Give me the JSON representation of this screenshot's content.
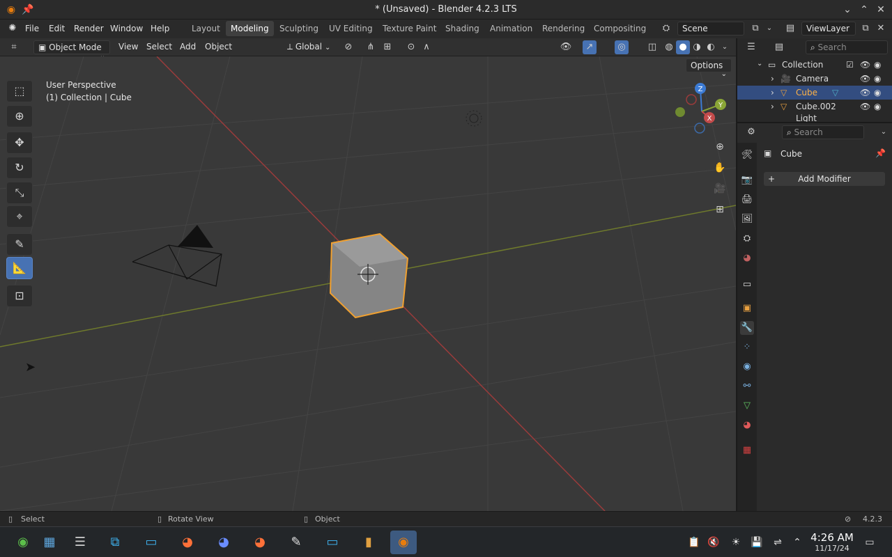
{
  "window": {
    "title": "* (Unsaved) - Blender 4.2.3 LTS"
  },
  "menubar": {
    "items": [
      "File",
      "Edit",
      "Render",
      "Window",
      "Help"
    ],
    "workspaces": [
      "Layout",
      "Modeling",
      "Sculpting",
      "UV Editing",
      "Texture Paint",
      "Shading",
      "Animation",
      "Rendering",
      "Compositing"
    ],
    "active_workspace": "Modeling",
    "scene": "Scene",
    "view_layer": "ViewLayer"
  },
  "viewport_header": {
    "mode": "Object Mode",
    "menus": [
      "View",
      "Select",
      "Add",
      "Object"
    ],
    "transform_orientation": "Global",
    "options_label": "Options"
  },
  "viewport": {
    "perspective_label": "User Perspective",
    "context_label": "(1) Collection | Cube",
    "gizmo_axes": [
      "Z",
      "Y",
      "X"
    ]
  },
  "outliner": {
    "search_placeholder": "Search",
    "rows": [
      {
        "name": "Collection",
        "selected": false
      },
      {
        "name": "Camera",
        "selected": false
      },
      {
        "name": "Cube",
        "selected": true
      },
      {
        "name": "Cube.002",
        "selected": false
      },
      {
        "name": "Light",
        "selected": false
      }
    ]
  },
  "properties": {
    "search_placeholder": "Search",
    "object_name": "Cube",
    "add_modifier_label": "Add Modifier"
  },
  "statusbar": {
    "select": "Select",
    "rotate": "Rotate View",
    "object": "Object",
    "version": "4.2.3"
  },
  "taskbar": {
    "time": "4:26 AM",
    "date": "11/17/24"
  },
  "colors": {
    "accent": "#4772b3",
    "selection_orange": "#f0a030",
    "x_axis": "#c44b4b",
    "y_axis": "#8aa536",
    "z_axis": "#3c7bd4"
  }
}
